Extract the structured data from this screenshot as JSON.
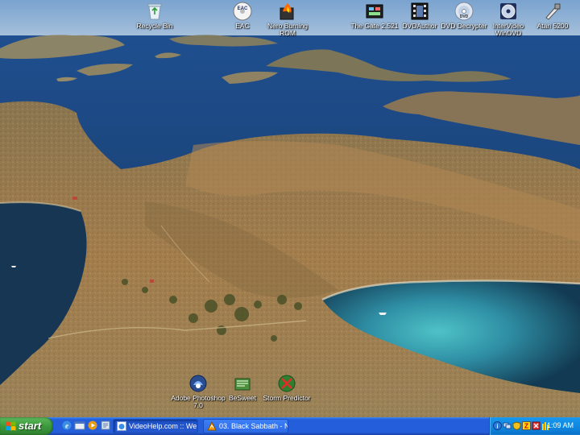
{
  "desktop": {
    "icons": [
      {
        "label": "Recycle Bin"
      },
      {
        "label": "EAC"
      },
      {
        "label": "Nero Burning ROM"
      },
      {
        "label": "The Gate 2.521"
      },
      {
        "label": "DVDAuthor"
      },
      {
        "label": "DVD Decrypter"
      },
      {
        "label": "InterVideo WinDVD"
      },
      {
        "label": "Atari 5200"
      },
      {
        "label": "Adobe Photoshop 7.0"
      },
      {
        "label": "BeSweet"
      },
      {
        "label": "Storm Predictor"
      }
    ]
  },
  "taskbar": {
    "start_label": "start",
    "quick_launch": [
      "ie-icon",
      "show-desktop-icon",
      "media-player-icon",
      "extra-app-icon"
    ],
    "tasks": [
      {
        "label": "VideoHelp.com :: We ..."
      },
      {
        "label": "03. Black Sabbath - N..."
      }
    ],
    "clock": "1:09 AM"
  },
  "colors": {
    "taskbar_blue": "#245edb",
    "start_green": "#3c9a3c",
    "tray_blue": "#0f86de",
    "sea": "#1d4a86",
    "land": "#9c7a4a"
  }
}
